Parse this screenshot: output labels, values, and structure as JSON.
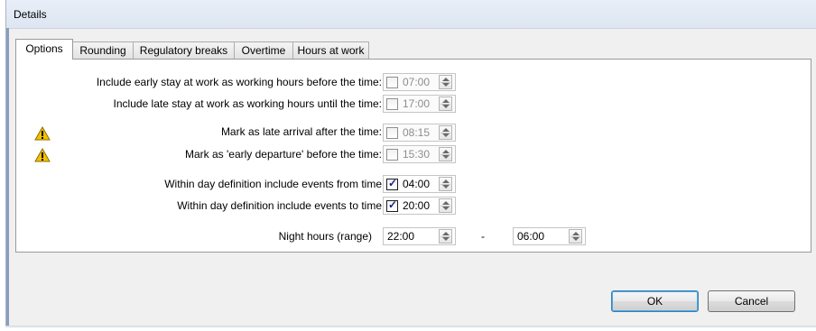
{
  "window": {
    "title": "Details"
  },
  "tabs": [
    {
      "label": "Options",
      "active": true
    },
    {
      "label": "Rounding",
      "active": false
    },
    {
      "label": "Regulatory breaks",
      "active": false
    },
    {
      "label": "Overtime",
      "active": false
    },
    {
      "label": "Hours at work",
      "active": false
    }
  ],
  "options": {
    "early_stay": {
      "label": "Include early stay at work as working hours before the time:",
      "checked": false,
      "time": "07:00"
    },
    "late_stay": {
      "label": "Include late stay at work as working hours until the time:",
      "checked": false,
      "time": "17:00"
    },
    "late_arrival": {
      "label": "Mark as late arrival after the time:",
      "checked": false,
      "time": "08:15",
      "warning_icon": "warning-icon"
    },
    "early_departure": {
      "label": "Mark as 'early departure' before the time:",
      "checked": false,
      "time": "15:30",
      "warning_icon": "warning-icon"
    },
    "events_from": {
      "label": "Within day definition include events from time",
      "checked": true,
      "time": "04:00"
    },
    "events_to": {
      "label": "Within day definition include events to time",
      "checked": true,
      "time": "20:00"
    },
    "night_hours": {
      "label": "Night hours (range)",
      "from": "22:00",
      "separator": "-",
      "to": "06:00"
    }
  },
  "buttons": {
    "ok": "OK",
    "cancel": "Cancel"
  },
  "colors": {
    "warning": "#f2c200",
    "check": "#1c1c8c",
    "default_button_border": "#3c7fb1"
  }
}
